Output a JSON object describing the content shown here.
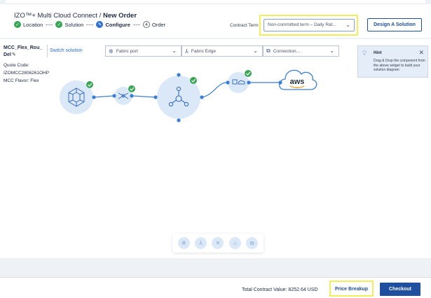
{
  "header": {
    "title_prefix": "IZO™+ Multi Cloud Connect",
    "title_sep": " / ",
    "title_page": "New Order",
    "steps": [
      {
        "label": "Location",
        "state": "done",
        "marker": "✓"
      },
      {
        "label": "Solution",
        "state": "done",
        "marker": "✓"
      },
      {
        "label": "Configure",
        "state": "current",
        "marker": "✎"
      },
      {
        "label": "Order",
        "state": "todo",
        "marker": "4"
      }
    ],
    "contract_term_label": "Contract Term",
    "contract_term_value": "Non-committed term – Daily Rat...",
    "design_button": "Design A Solution"
  },
  "solution": {
    "name": "MCC_Flex_Rou_ Del",
    "switch_link": "Switch solution",
    "quote_code_label": "Quote Code:",
    "quote_code": "IZOMCC2806261OHP",
    "flavor": "MCC Flavor: Flex"
  },
  "dropdowns": [
    {
      "label": "Fabric port",
      "icon": "fabric-port-icon"
    },
    {
      "label": "Fabric Edge",
      "icon": "fabric-edge-icon"
    },
    {
      "label": "Connection...",
      "icon": "connection-icon"
    }
  ],
  "hint": {
    "title": "Hint",
    "text": "Drag & Drop the component from the above widget to build your solution diagram"
  },
  "diagram": {
    "cloud_label": "aws"
  },
  "footer": {
    "total_label": "Total Contract Value:",
    "total_value": "8252.64 USD",
    "price_breakup": "Price Breakup",
    "checkout": "Checkout"
  },
  "colors": {
    "accent": "#1f4f9e",
    "highlight": "#f2ee5a",
    "done": "#3aa757",
    "node_fill": "#dbe8f8"
  }
}
